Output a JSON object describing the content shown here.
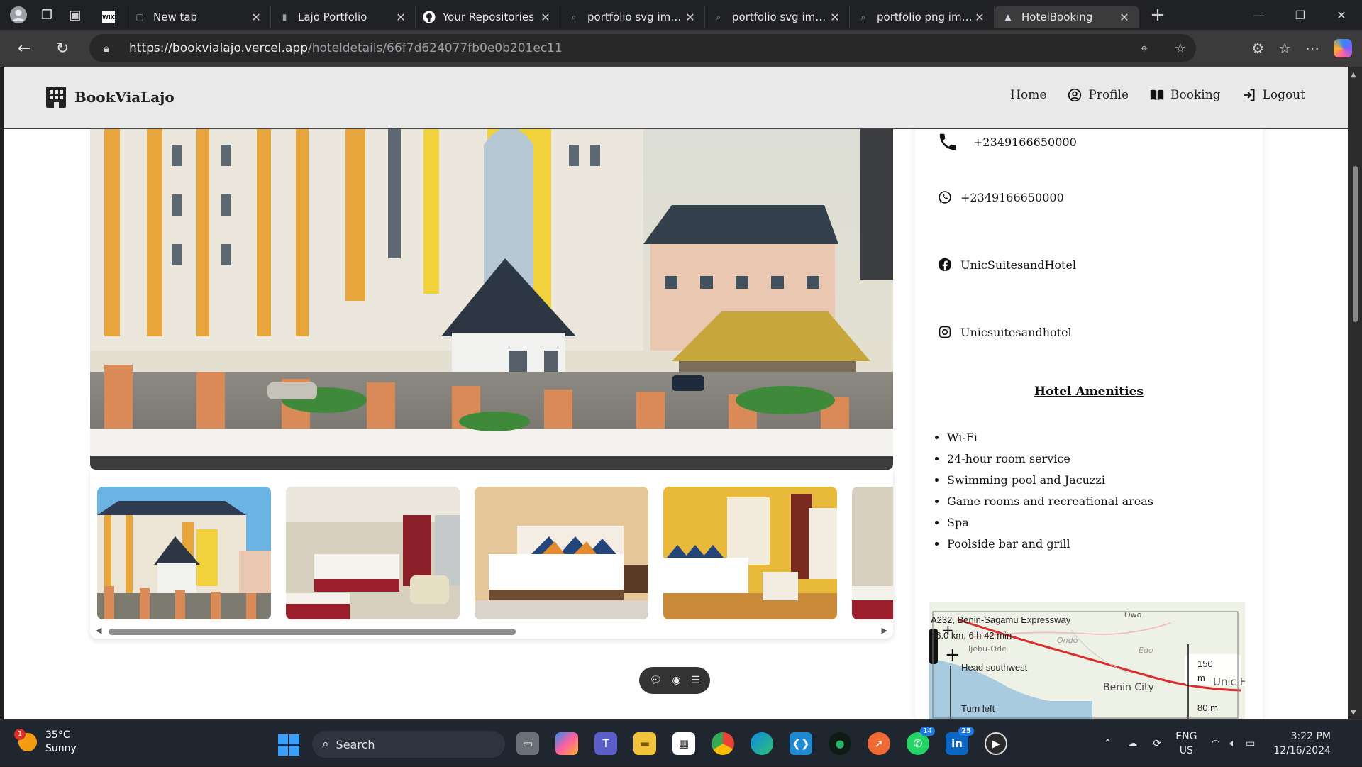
{
  "browser": {
    "tabs": [
      {
        "title": "",
        "icon": "wix-icon"
      },
      {
        "title": "New tab",
        "icon": "newtab-icon"
      },
      {
        "title": "Lajo Portfolio",
        "icon": "portfolio-icon"
      },
      {
        "title": "Your Repositories",
        "icon": "github-icon"
      },
      {
        "title": "portfolio svg image",
        "icon": "search-icon"
      },
      {
        "title": "portfolio svg image",
        "icon": "search-icon"
      },
      {
        "title": "portfolio png imag",
        "icon": "search-icon"
      },
      {
        "title": "HotelBooking",
        "icon": "hotel-icon"
      }
    ],
    "active_tab_index": 7,
    "url_host": "https://bookvialajo.vercel.app",
    "url_path": "/hoteldetails/66f7d624077fb0e0b201ec11"
  },
  "site": {
    "brand": "BookViaLajo",
    "nav": {
      "home": "Home",
      "profile": "Profile",
      "booking": "Booking",
      "logout": "Logout"
    }
  },
  "hotel": {
    "phone": "+2349166650000",
    "whatsapp": "+2349166650000",
    "facebook": "UnicSuitesandHotel",
    "instagram": "Unicsuitesandhotel",
    "amenities_title": "Hotel Amenities",
    "amenities": [
      "Wi-Fi",
      "24-hour room service",
      "Swimming pool and Jacuzzi",
      "Game rooms and recreational areas",
      "Spa",
      "Poolside bar and grill"
    ],
    "gallery_count": 5
  },
  "map": {
    "route_name": "A232, Benin-Sagamu Expressway",
    "route_info": "46.0 km, 6 h 42 min",
    "step1": "Head southwest",
    "step2": "Turn left",
    "dist1": "150",
    "dist1_unit": "m",
    "dist2": "80 m",
    "place_owo": "Owo",
    "place_ondo": "Ondo",
    "place_edo": "Edo",
    "place_ijebu": "Ijebu-Ode",
    "place_benin": "Benin City",
    "place_unic": "Unic H"
  },
  "taskbar": {
    "weather_badge": "1",
    "temperature": "35°C",
    "condition": "Sunny",
    "search_label": "Search",
    "teams_badge": "14",
    "linkedin_badge": "25",
    "lang_top": "ENG",
    "lang_bottom": "US",
    "time": "3:22 PM",
    "date": "12/16/2024"
  }
}
